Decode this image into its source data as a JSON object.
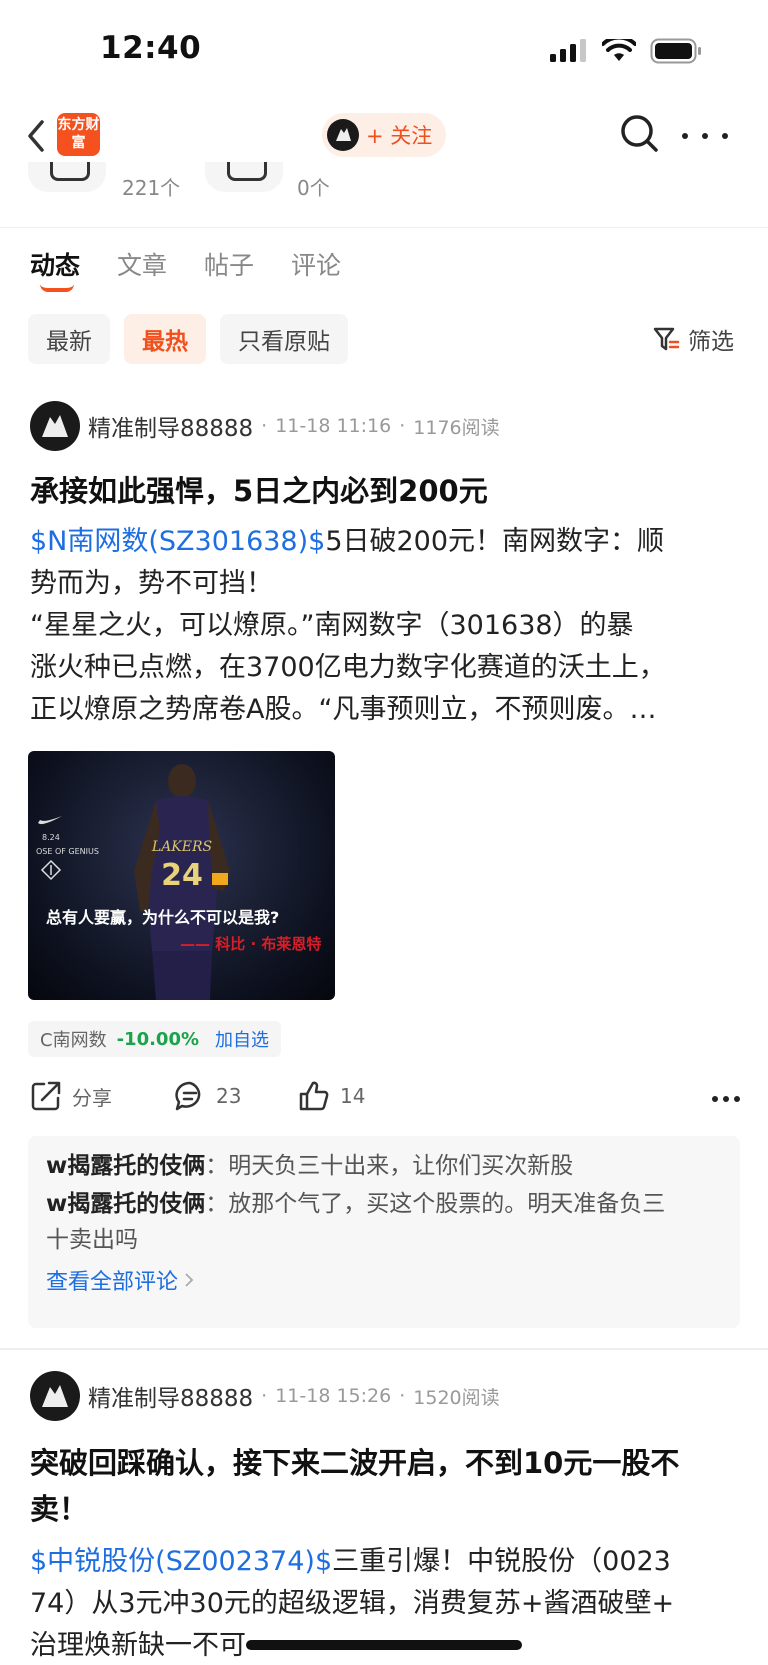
{
  "status_bar": {
    "time": "12:40"
  },
  "header": {
    "brand_logo_text": "东方财富",
    "follow_label": "+ 关注"
  },
  "stats": [
    {
      "count": "221个"
    },
    {
      "count": "0个"
    }
  ],
  "tabs": [
    {
      "label": "动态"
    },
    {
      "label": "文章"
    },
    {
      "label": "帖子"
    },
    {
      "label": "评论"
    }
  ],
  "filters": {
    "chips": [
      {
        "label": "最新"
      },
      {
        "label": "最热"
      },
      {
        "label": "只看原贴"
      }
    ],
    "filter_label": "筛选"
  },
  "posts": [
    {
      "author": "精准制导88888",
      "time": "11-18 11:16",
      "reads": "1176阅读",
      "title": "承接如此强悍，5日之内必到200元",
      "stock_link": "$N南网数(SZ301638)$",
      "body_line1_rest": "5日破200元！南网数字：顺",
      "body_line2": "势而为，势不可挡！",
      "body_line3": "“星星之火，可以燎原。”南网数字（301638）的暴",
      "body_line4": "涨火种已点燃，在3700亿电力数字化赛道的沃土上，",
      "body_line5": "正以燎原之势席卷A股。“凡事预则立，不预则废。…",
      "image": {
        "jersey_number": "24",
        "jersey_team": "LAKERS",
        "side_text": "8.24",
        "side_brand": "OSE OF GENIUS",
        "quote": "总有人要赢，为什么不可以是我?",
        "signature": "—— 科比 · 布莱恩特"
      },
      "stock_tag": {
        "name": "C南网数",
        "change": "-10.00%",
        "action": "加自选"
      },
      "actions": {
        "share": "分享",
        "comments": "23",
        "likes": "14"
      },
      "comments": [
        {
          "name": "w揭露托的伎俩",
          "text": "明天负三十出来，让你们买次新股"
        },
        {
          "name": "w揭露托的伎俩",
          "text": "放那个气了，买这个股票的。明天准备负三",
          "text2": "十卖出吗"
        }
      ],
      "view_all": "查看全部评论"
    },
    {
      "author": "精准制导88888",
      "time": "11-18 15:26",
      "reads": "1520阅读",
      "title_line1": "突破回踩确认，接下来二波开启，不到10元一股不",
      "title_line2": "卖！",
      "stock_link": "$中锐股份(SZ002374)$",
      "body_line1_rest": "三重引爆！中锐股份（0023",
      "body_line2": "74）从3元冲30元的超级逻辑，消费复苏+酱酒破壁+",
      "body_line3": "治理焕新缺一不可"
    }
  ],
  "colors": {
    "accent": "#f0501e",
    "link": "#1f6ee0",
    "down": "#1aa34a"
  }
}
